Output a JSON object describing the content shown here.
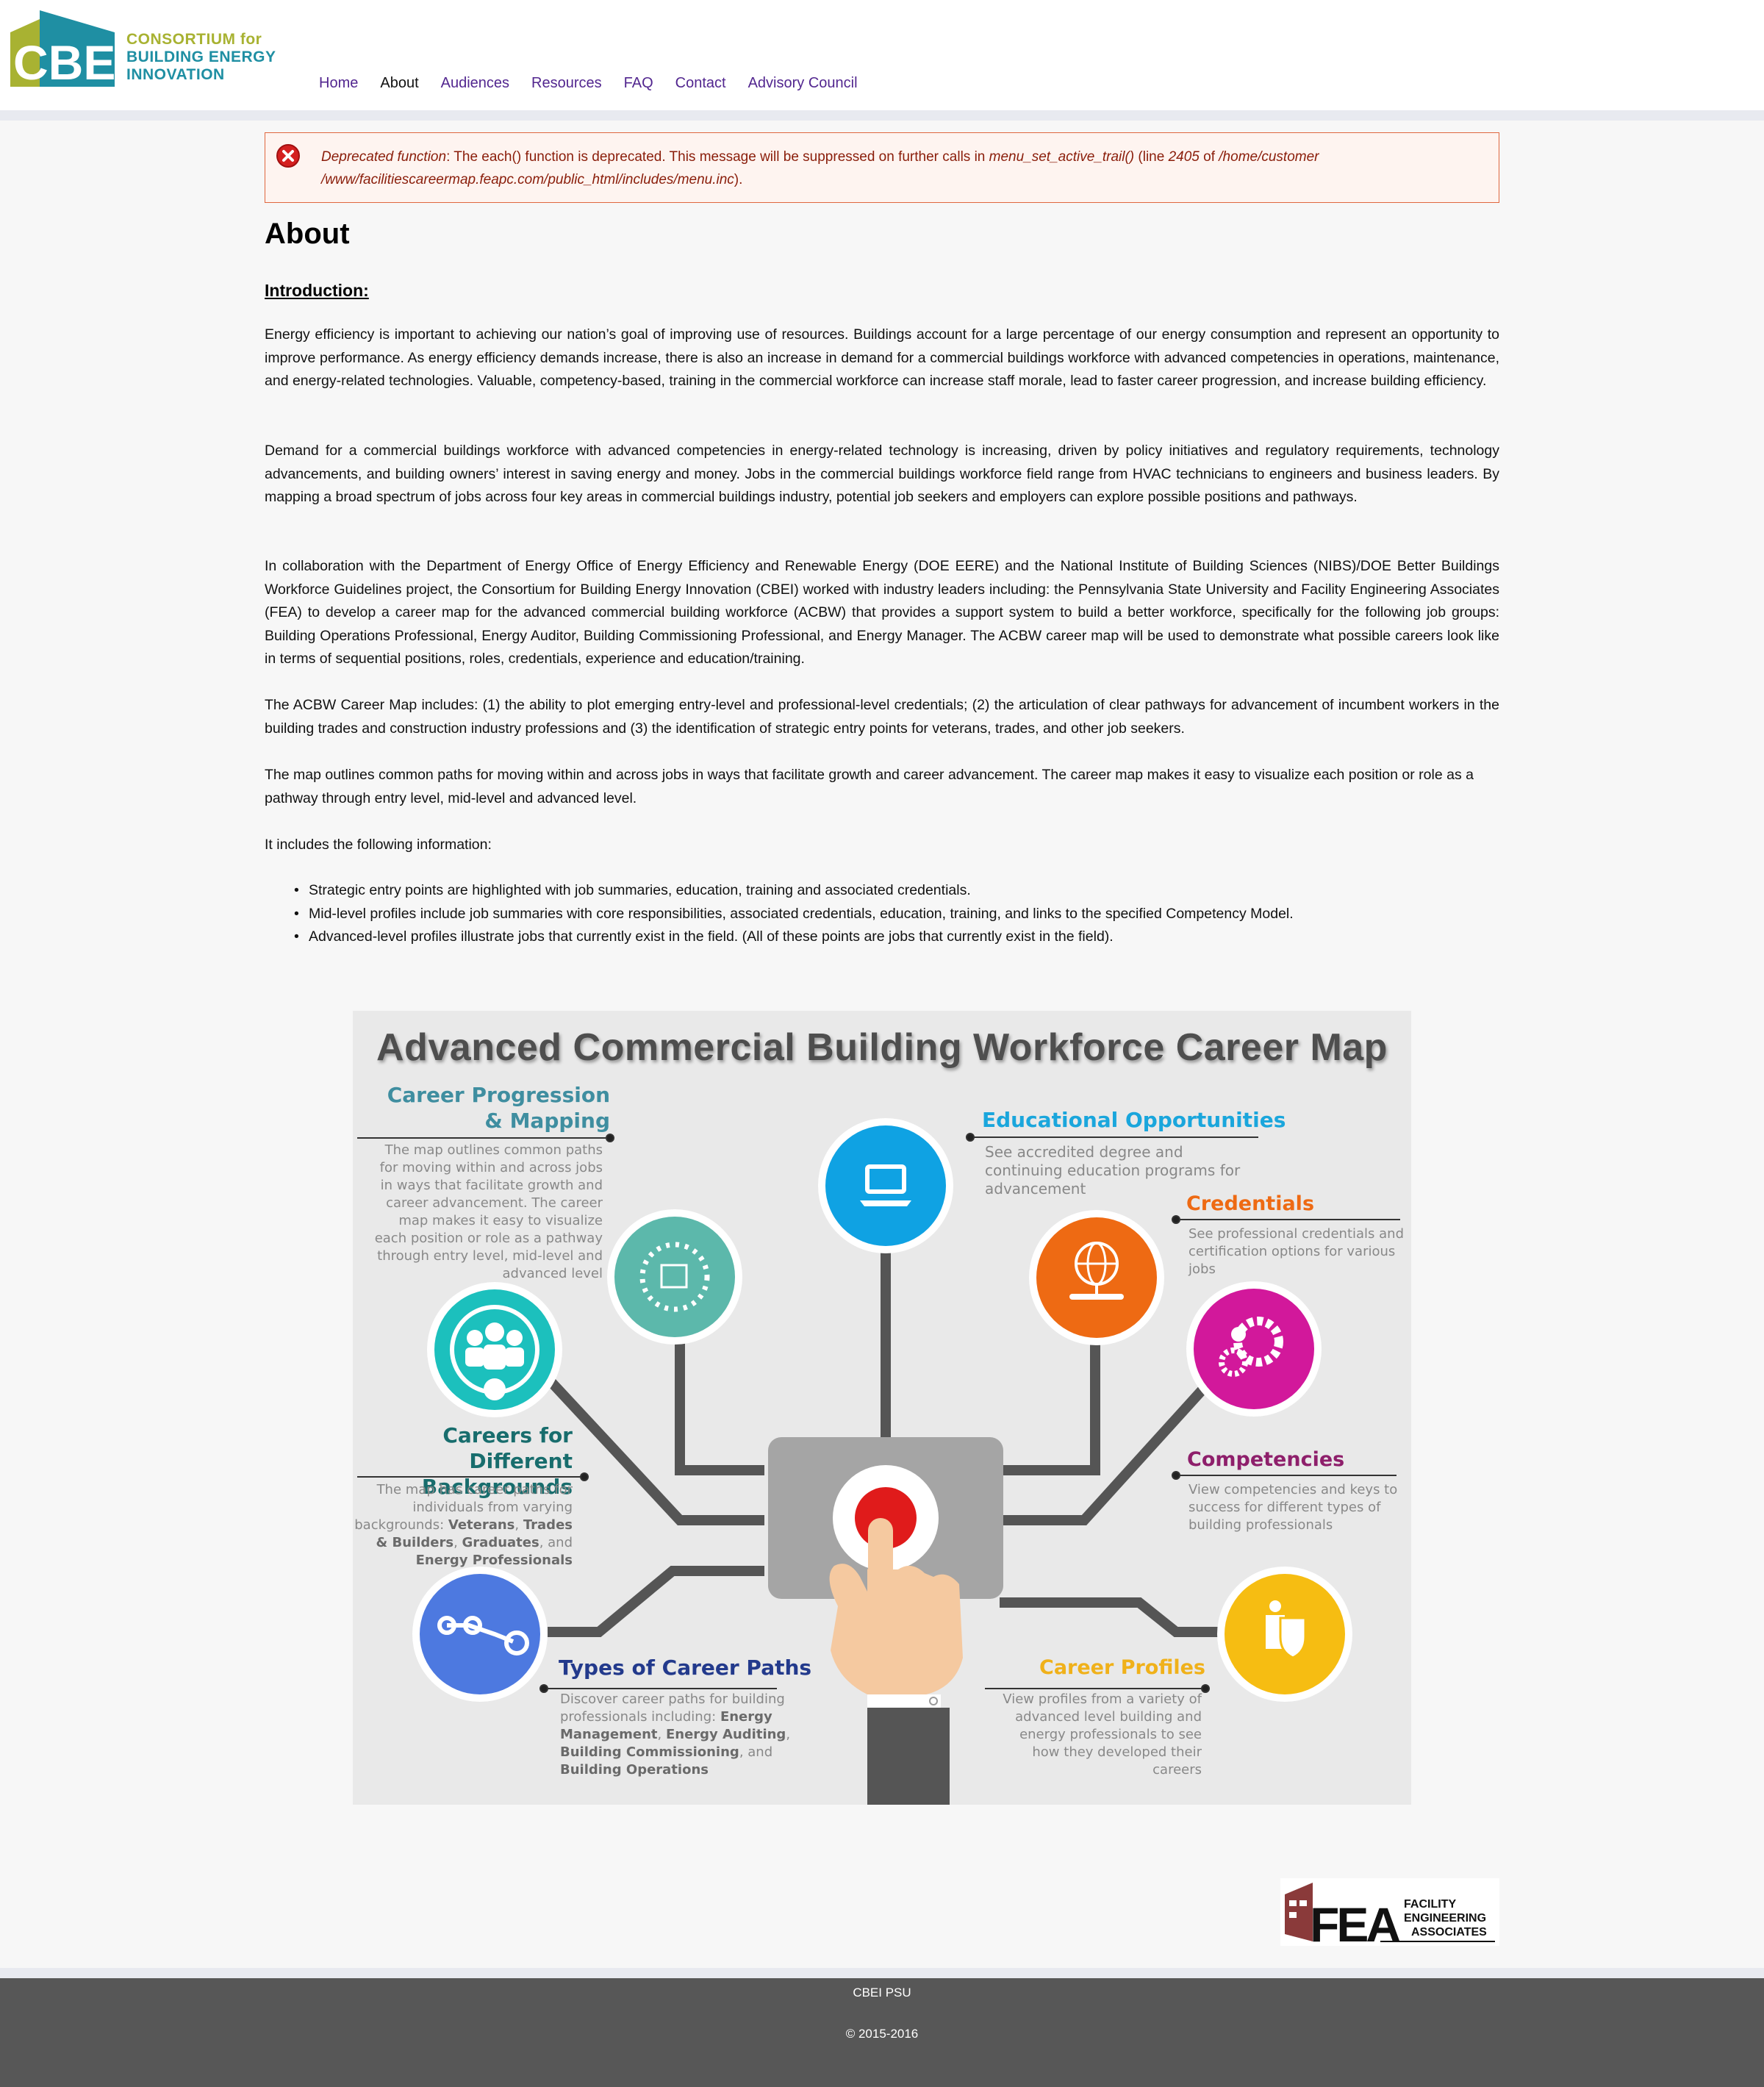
{
  "header": {
    "logo": {
      "mark_text": "CBEI",
      "line1": "CONSORTIUM for",
      "line2": "BUILDING ENERGY",
      "line3": "INNOVATION"
    },
    "nav": [
      {
        "label": "Home",
        "active": false
      },
      {
        "label": "About",
        "active": true
      },
      {
        "label": "Audiences",
        "active": false
      },
      {
        "label": "Resources",
        "active": false
      },
      {
        "label": "FAQ",
        "active": false
      },
      {
        "label": "Contact",
        "active": false
      },
      {
        "label": "Advisory Council",
        "active": false
      }
    ]
  },
  "error": {
    "label": "Deprecated function",
    "text1": ": The each() function is deprecated. This message will be suppressed on further calls in ",
    "function_name": "menu_set_active_trail()",
    "text2": " (line ",
    "line_number": "2405",
    "text3": " of ",
    "path": "/home/customer /www/facilitiescareermap.feapc.com/public_html/includes/menu.inc",
    "text4": ").",
    "icon": "error-x-icon"
  },
  "page": {
    "title": "About",
    "intro_heading": "Introduction: ",
    "paragraphs": [
      "Energy efficiency is important to achieving our nation’s goal of improving use of resources. Buildings account for a large percentage of our energy consumption and represent an opportunity to improve performance. As energy efficiency demands increase, there is also an increase in demand for a commercial buildings workforce with advanced competencies in operations, maintenance, and energy-related technologies. Valuable, competency-based, training in the commercial workforce can increase staff morale, lead to faster career progression, and increase building efficiency.",
      "Demand for a commercial buildings workforce with advanced competencies in energy-related technology is increasing, driven by policy initiatives and regulatory requirements, technology advancements, and building owners’ interest in saving energy and money. Jobs in the commercial buildings workforce field range from HVAC technicians to engineers and business leaders. By mapping a broad spectrum of jobs across four key areas in commercial buildings industry, potential job seekers and employers can explore possible positions and pathways.",
      "In collaboration with the Department of Energy Office of Energy Efficiency and Renewable Energy (DOE EERE) and the National Institute of Building Sciences (NIBS)/DOE Better Buildings Workforce Guidelines project, the Consortium for Building Energy Innovation (CBEI) worked with industry leaders including: the Pennsylvania State University and Facility Engineering Associates (FEA) to develop a career map for the advanced commercial building workforce (ACBW) that provides a support system to build a better workforce, specifically for the following job groups: Building Operations Professional, Energy Auditor, Building Commissioning Professional, and Energy Manager. The ACBW career map will be used to demonstrate what possible careers look like in terms of sequential positions, roles, credentials, experience and education/training.",
      "The ACBW Career Map includes: (1) the ability to plot emerging entry-level and professional-level credentials; (2) the articulation of clear pathways for advancement of incumbent workers in the building trades and construction industry professions and (3) the identification of strategic entry points for veterans, trades, and other job seekers.",
      "The map outlines common paths for moving within and across jobs in ways that facilitate growth and career advancement. The career map makes it easy to visualize each position or role as a pathway through entry level, mid-level and advanced level.",
      "It includes the following information:"
    ],
    "bullets": [
      "Strategic entry points are highlighted with job summaries, education, training and associated credentials.",
      "Mid-level profiles include job summaries with core responsibilities, associated credentials, education, training, and links to the specified Competency Model.",
      "Advanced-level profiles illustrate jobs that currently exist in the field.  (All of these points are jobs that currently exist in the field)."
    ]
  },
  "career_map": {
    "title": "Advanced Commercial Building Workforce Career Map",
    "sections": {
      "progression": {
        "heading_l1": "Career Progression",
        "heading_l2": "& Mapping",
        "lines": [
          "The map outlines common paths",
          "for moving within and across jobs",
          "in ways that facilitate growth and",
          "career advancement. The career",
          "map makes it easy to visualize",
          "each position or role as a pathway",
          "through entry level, mid-level and",
          "advanced level"
        ],
        "color": "#3f8ea0"
      },
      "education": {
        "heading": "Educational Opportunities",
        "lines": [
          "See accredited degree and",
          "continuing education programs for",
          "advancement"
        ],
        "color": "#1aa6dc"
      },
      "credentials": {
        "heading": "Credentials",
        "lines": [
          "See professional credentials and",
          "certification options for various",
          "jobs"
        ],
        "color": "#ee6a13"
      },
      "backgrounds": {
        "heading_l1": "Careers for Different",
        "heading_l2": "Backgrounds",
        "l1": "The map has career paths for",
        "l2": "individuals from varying",
        "l3a": "backgrounds: ",
        "l3b": "Veterans",
        "l3c": ", ",
        "l3d": "Trades",
        "l4a": "& Builders",
        "l4b": ", ",
        "l4c": "Graduates",
        "l4d": ", and",
        "l5": "Energy Professionals",
        "color": "#186d6d"
      },
      "competencies": {
        "heading": "Competencies",
        "lines": [
          "View competencies and keys to",
          "success for different types of",
          "building professionals"
        ],
        "color": "#8e1f6b"
      },
      "paths": {
        "heading": "Types of Career Paths",
        "l1": "Discover career paths for building",
        "l2a": "professionals including: ",
        "l2b": "Energy",
        "l3a": "Management",
        "l3b": ", ",
        "l3c": "Energy Auditing",
        "l3d": ",",
        "l4a": "Building Commissioning",
        "l4b": ", and",
        "l5": "Building Operations",
        "color": "#233a8c"
      },
      "profiles": {
        "heading": "Career Profiles",
        "lines": [
          "View profiles from a variety of",
          "advanced level building and",
          "energy professionals to see",
          "how they developed their",
          "careers"
        ],
        "color": "#f0b11a"
      }
    },
    "icons": [
      "laptop-icon",
      "network-icon",
      "people-icon",
      "globe-network-icon",
      "gears-icon",
      "nodes-icon",
      "id-badge-icon",
      "push-button-icon",
      "hand-pointer-icon"
    ]
  },
  "fea_logo": {
    "letters": "FEA",
    "line1": "FACILITY",
    "line2": "ENGINEERING",
    "line3": "ASSOCIATES"
  },
  "footer": {
    "org": "CBEI PSU",
    "copyright": "© 2015-2016"
  }
}
